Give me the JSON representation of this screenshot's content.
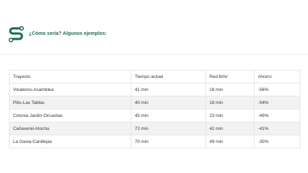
{
  "header": {
    "title": "¿Cómo sería? Algunos ejemplos:",
    "logo_icon": "route-s-logo-icon",
    "accent_color": "#1f6b5b"
  },
  "table": {
    "columns": [
      "Trayecto",
      "Tiempo actual",
      "Red BAV",
      "Ahorro"
    ],
    "rows": [
      [
        "Vinateros-Asamblea",
        "41 min",
        "18 min",
        "-56%"
      ],
      [
        "Pitis-Las Tablas",
        "40 min",
        "18 min",
        "-54%"
      ],
      [
        "Colonia Jardín-Orcasitas",
        "45 min",
        "23 min",
        "-49%"
      ],
      [
        "Cañaveral-Atocha",
        "72 min",
        "42 min",
        "-41%"
      ],
      [
        "La Gavia-Canillejas",
        "70 min",
        "49 min",
        "-30%"
      ]
    ]
  }
}
